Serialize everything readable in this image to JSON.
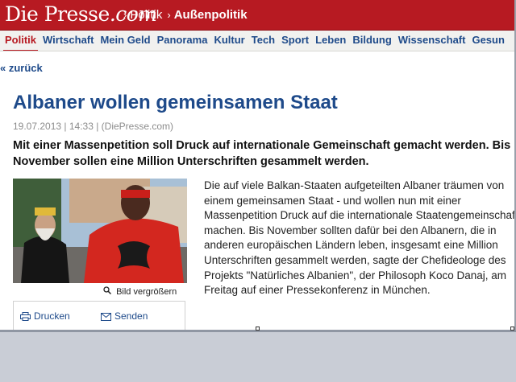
{
  "header": {
    "logo_main": "Die Presse",
    "logo_suffix": ".com",
    "breadcrumb": {
      "section": "Politik",
      "current": "Außenpolitik"
    }
  },
  "nav": {
    "items": [
      "Politik",
      "Wirtschaft",
      "Mein Geld",
      "Panorama",
      "Kultur",
      "Tech",
      "Sport",
      "Leben",
      "Bildung",
      "Wissenschaft",
      "Gesun"
    ],
    "active": "Politik"
  },
  "back_link": "« zurück",
  "article": {
    "title": "Albaner wollen gemeinsamen Staat",
    "meta": "19.07.2013 | 14:33 |   (DiePresse.com)",
    "lead": "Mit einer Massenpetition soll Druck auf internationale Gemeinschaft gemacht werden. Bis November sollen eine Million Unterschriften gesammelt werden.",
    "body": "Die auf viele Balkan-Staaten aufgeteilten Albaner träumen von einem gemeinsamen Staat - und wollen nun mit einer Massenpetition Druck auf die internationale Staatengemeinschaft machen. Bis November sollten dafür bei den Albanern, die in anderen europäischen Ländern leben, insgesamt eine Million Unterschriften gesammelt werden, sagte der Chefideologe des Projekts \"Natürliches Albanien\", der Philosoph Koco Danaj, am Freitag auf einer Pressekonferenz in München.",
    "enlarge_label": "Bild vergrößern"
  },
  "tools": {
    "print_label": "Drucken",
    "send_label": "Senden"
  },
  "icons": {
    "enlarge": "magnifier-icon",
    "print": "printer-icon",
    "send": "envelope-icon"
  },
  "colors": {
    "brand_red": "#b71a22",
    "link_blue": "#1e4a8a"
  }
}
